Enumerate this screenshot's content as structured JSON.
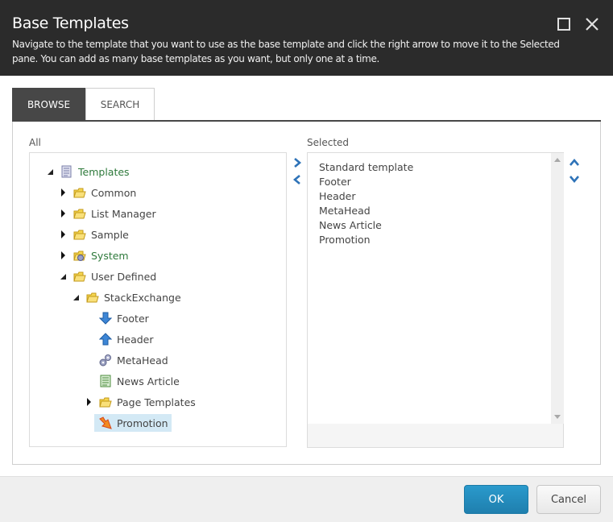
{
  "dialog": {
    "title": "Base Templates",
    "description": "Navigate to the template that you want to use as the base template and click the right arrow to move it to the Selected pane. You can add as many base templates as you want, but only one at a time.",
    "window_buttons": {
      "maximize": "maximize-icon",
      "close": "close-icon"
    }
  },
  "tabs": [
    {
      "label": "BROWSE",
      "active": true
    },
    {
      "label": "SEARCH",
      "active": false
    }
  ],
  "all_pane": {
    "label": "All",
    "tree": [
      {
        "label": "Templates",
        "icon": "template-icon",
        "expanded": true,
        "level": 0,
        "green": true
      },
      {
        "label": "Common",
        "icon": "folder-icon",
        "expanded": false,
        "level": 1
      },
      {
        "label": "List Manager",
        "icon": "folder-icon",
        "expanded": false,
        "level": 1
      },
      {
        "label": "Sample",
        "icon": "folder-icon",
        "expanded": false,
        "level": 1
      },
      {
        "label": "System",
        "icon": "system-folder-icon",
        "expanded": false,
        "level": 1,
        "green": true
      },
      {
        "label": "User Defined",
        "icon": "folder-icon",
        "expanded": true,
        "level": 1
      },
      {
        "label": "StackExchange",
        "icon": "folder-icon",
        "expanded": true,
        "level": 2
      },
      {
        "label": "Footer",
        "icon": "arrow-down-icon",
        "level": 3
      },
      {
        "label": "Header",
        "icon": "arrow-up-icon",
        "level": 3
      },
      {
        "label": "MetaHead",
        "icon": "gears-icon",
        "level": 3
      },
      {
        "label": "News Article",
        "icon": "document-icon",
        "level": 3
      },
      {
        "label": "Page Templates",
        "icon": "folder-icon",
        "expanded": false,
        "level": 3
      },
      {
        "label": "Promotion",
        "icon": "promotion-icon",
        "level": 3,
        "selected": true
      }
    ]
  },
  "selected_pane": {
    "label": "Selected",
    "items": [
      "Standard template",
      "Footer",
      "Header",
      "MetaHead",
      "News Article",
      "Promotion"
    ]
  },
  "footer": {
    "ok_label": "OK",
    "cancel_label": "Cancel"
  },
  "colors": {
    "header_bg": "#2b2b2b",
    "accent": "#2a8ec0",
    "selected_row": "#d3e9f5",
    "green_label": "#2f7a3c"
  }
}
